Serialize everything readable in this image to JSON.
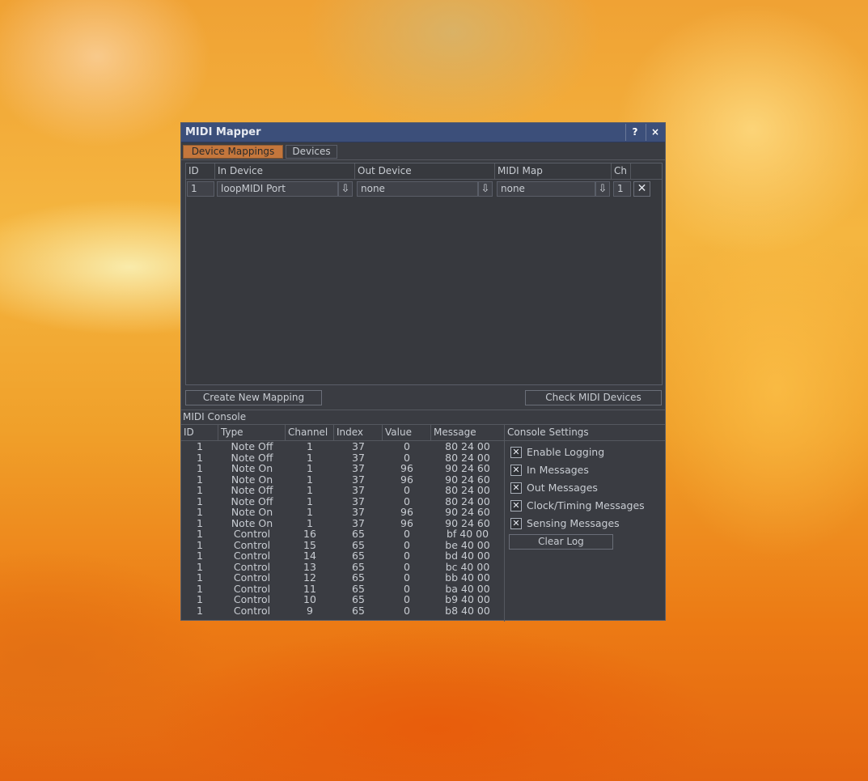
{
  "window": {
    "title": "MIDI Mapper",
    "help_label": "?",
    "close_label": "×"
  },
  "tabs": [
    {
      "label": "Device Mappings",
      "active": true
    },
    {
      "label": "Devices",
      "active": false
    }
  ],
  "mappings": {
    "columns": [
      "ID",
      "In Device",
      "Out Device",
      "MIDI Map",
      "Ch"
    ],
    "rows": [
      {
        "id": "1",
        "in_device": "loopMIDI Port",
        "out_device": "none",
        "midi_map": "none",
        "ch": "1"
      }
    ],
    "dropdown_icon": "⇩",
    "delete_icon": "✕"
  },
  "buttons": {
    "create": "Create New Mapping",
    "check": "Check MIDI Devices"
  },
  "console": {
    "title": "MIDI Console",
    "columns": [
      "ID",
      "Type",
      "Channel",
      "Index",
      "Value",
      "Message"
    ],
    "rows": [
      [
        "1",
        "Note Off",
        "1",
        "37",
        "0",
        "80 24 00"
      ],
      [
        "1",
        "Note Off",
        "1",
        "37",
        "0",
        "80 24 00"
      ],
      [
        "1",
        "Note On",
        "1",
        "37",
        "96",
        "90 24 60"
      ],
      [
        "1",
        "Note On",
        "1",
        "37",
        "96",
        "90 24 60"
      ],
      [
        "1",
        "Note Off",
        "1",
        "37",
        "0",
        "80 24 00"
      ],
      [
        "1",
        "Note Off",
        "1",
        "37",
        "0",
        "80 24 00"
      ],
      [
        "1",
        "Note On",
        "1",
        "37",
        "96",
        "90 24 60"
      ],
      [
        "1",
        "Note On",
        "1",
        "37",
        "96",
        "90 24 60"
      ],
      [
        "1",
        "Control",
        "16",
        "65",
        "0",
        "bf 40 00"
      ],
      [
        "1",
        "Control",
        "15",
        "65",
        "0",
        "be 40 00"
      ],
      [
        "1",
        "Control",
        "14",
        "65",
        "0",
        "bd 40 00"
      ],
      [
        "1",
        "Control",
        "13",
        "65",
        "0",
        "bc 40 00"
      ],
      [
        "1",
        "Control",
        "12",
        "65",
        "0",
        "bb 40 00"
      ],
      [
        "1",
        "Control",
        "11",
        "65",
        "0",
        "ba 40 00"
      ],
      [
        "1",
        "Control",
        "10",
        "65",
        "0",
        "b9 40 00"
      ],
      [
        "1",
        "Control",
        "9",
        "65",
        "0",
        "b8 40 00"
      ]
    ]
  },
  "settings": {
    "title": "Console Settings",
    "check_mark": "✕",
    "options": [
      {
        "label": "Enable Logging",
        "checked": true
      },
      {
        "label": "In Messages",
        "checked": true
      },
      {
        "label": "Out Messages",
        "checked": true
      },
      {
        "label": "Clock/Timing Messages",
        "checked": true
      },
      {
        "label": "Sensing Messages",
        "checked": true
      }
    ],
    "clear_label": "Clear Log"
  }
}
